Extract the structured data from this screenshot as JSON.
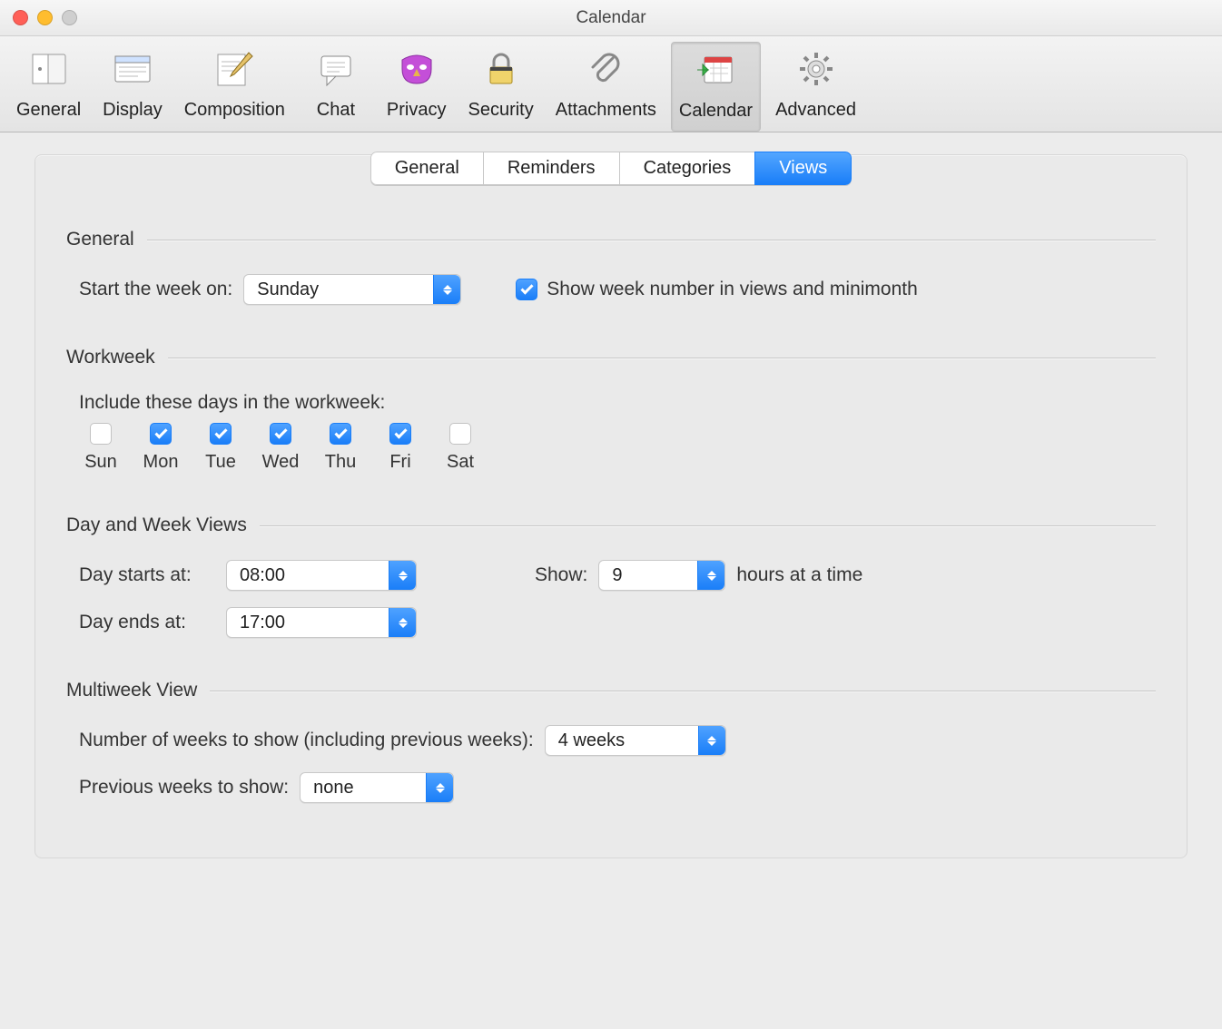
{
  "window": {
    "title": "Calendar"
  },
  "toolbar": {
    "items": [
      {
        "label": "General"
      },
      {
        "label": "Display"
      },
      {
        "label": "Composition"
      },
      {
        "label": "Chat"
      },
      {
        "label": "Privacy"
      },
      {
        "label": "Security"
      },
      {
        "label": "Attachments"
      },
      {
        "label": "Calendar"
      },
      {
        "label": "Advanced"
      }
    ]
  },
  "subtabs": {
    "items": [
      "General",
      "Reminders",
      "Categories",
      "Views"
    ]
  },
  "sections": {
    "general": {
      "title": "General",
      "start_week_label": "Start the week on:",
      "start_week_value": "Sunday",
      "show_week_label": "Show week number in views and minimonth",
      "show_week_checked": true
    },
    "workweek": {
      "title": "Workweek",
      "include_label": "Include these days in the workweek:",
      "days": [
        "Sun",
        "Mon",
        "Tue",
        "Wed",
        "Thu",
        "Fri",
        "Sat"
      ],
      "checked": [
        false,
        true,
        true,
        true,
        true,
        true,
        false
      ]
    },
    "dayweek": {
      "title": "Day and Week Views",
      "starts_label": "Day starts at:",
      "starts_value": "08:00",
      "ends_label": "Day ends at:",
      "ends_value": "17:00",
      "show_label": "Show:",
      "show_value": "9",
      "show_after": "hours at a time"
    },
    "multiweek": {
      "title": "Multiweek View",
      "num_weeks_label": "Number of weeks to show (including previous weeks):",
      "num_weeks_value": "4 weeks",
      "prev_weeks_label": "Previous weeks to show:",
      "prev_weeks_value": "none"
    }
  }
}
